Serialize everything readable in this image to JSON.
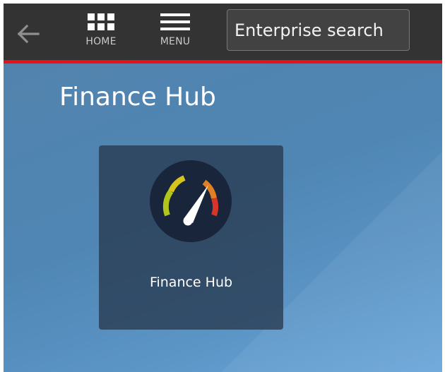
{
  "topbar": {
    "back_icon": "arrow-left-icon",
    "home": {
      "label": "HOME",
      "icon": "grid-icon"
    },
    "menu": {
      "label": "MENU",
      "icon": "hamburger-icon"
    },
    "search": {
      "placeholder": "Enterprise search",
      "value": ""
    },
    "accent_color": "#e3121b",
    "background_color": "#333333"
  },
  "main": {
    "title": "Finance Hub",
    "tiles": [
      {
        "label": "Finance Hub",
        "icon": "speedometer-icon"
      }
    ]
  }
}
